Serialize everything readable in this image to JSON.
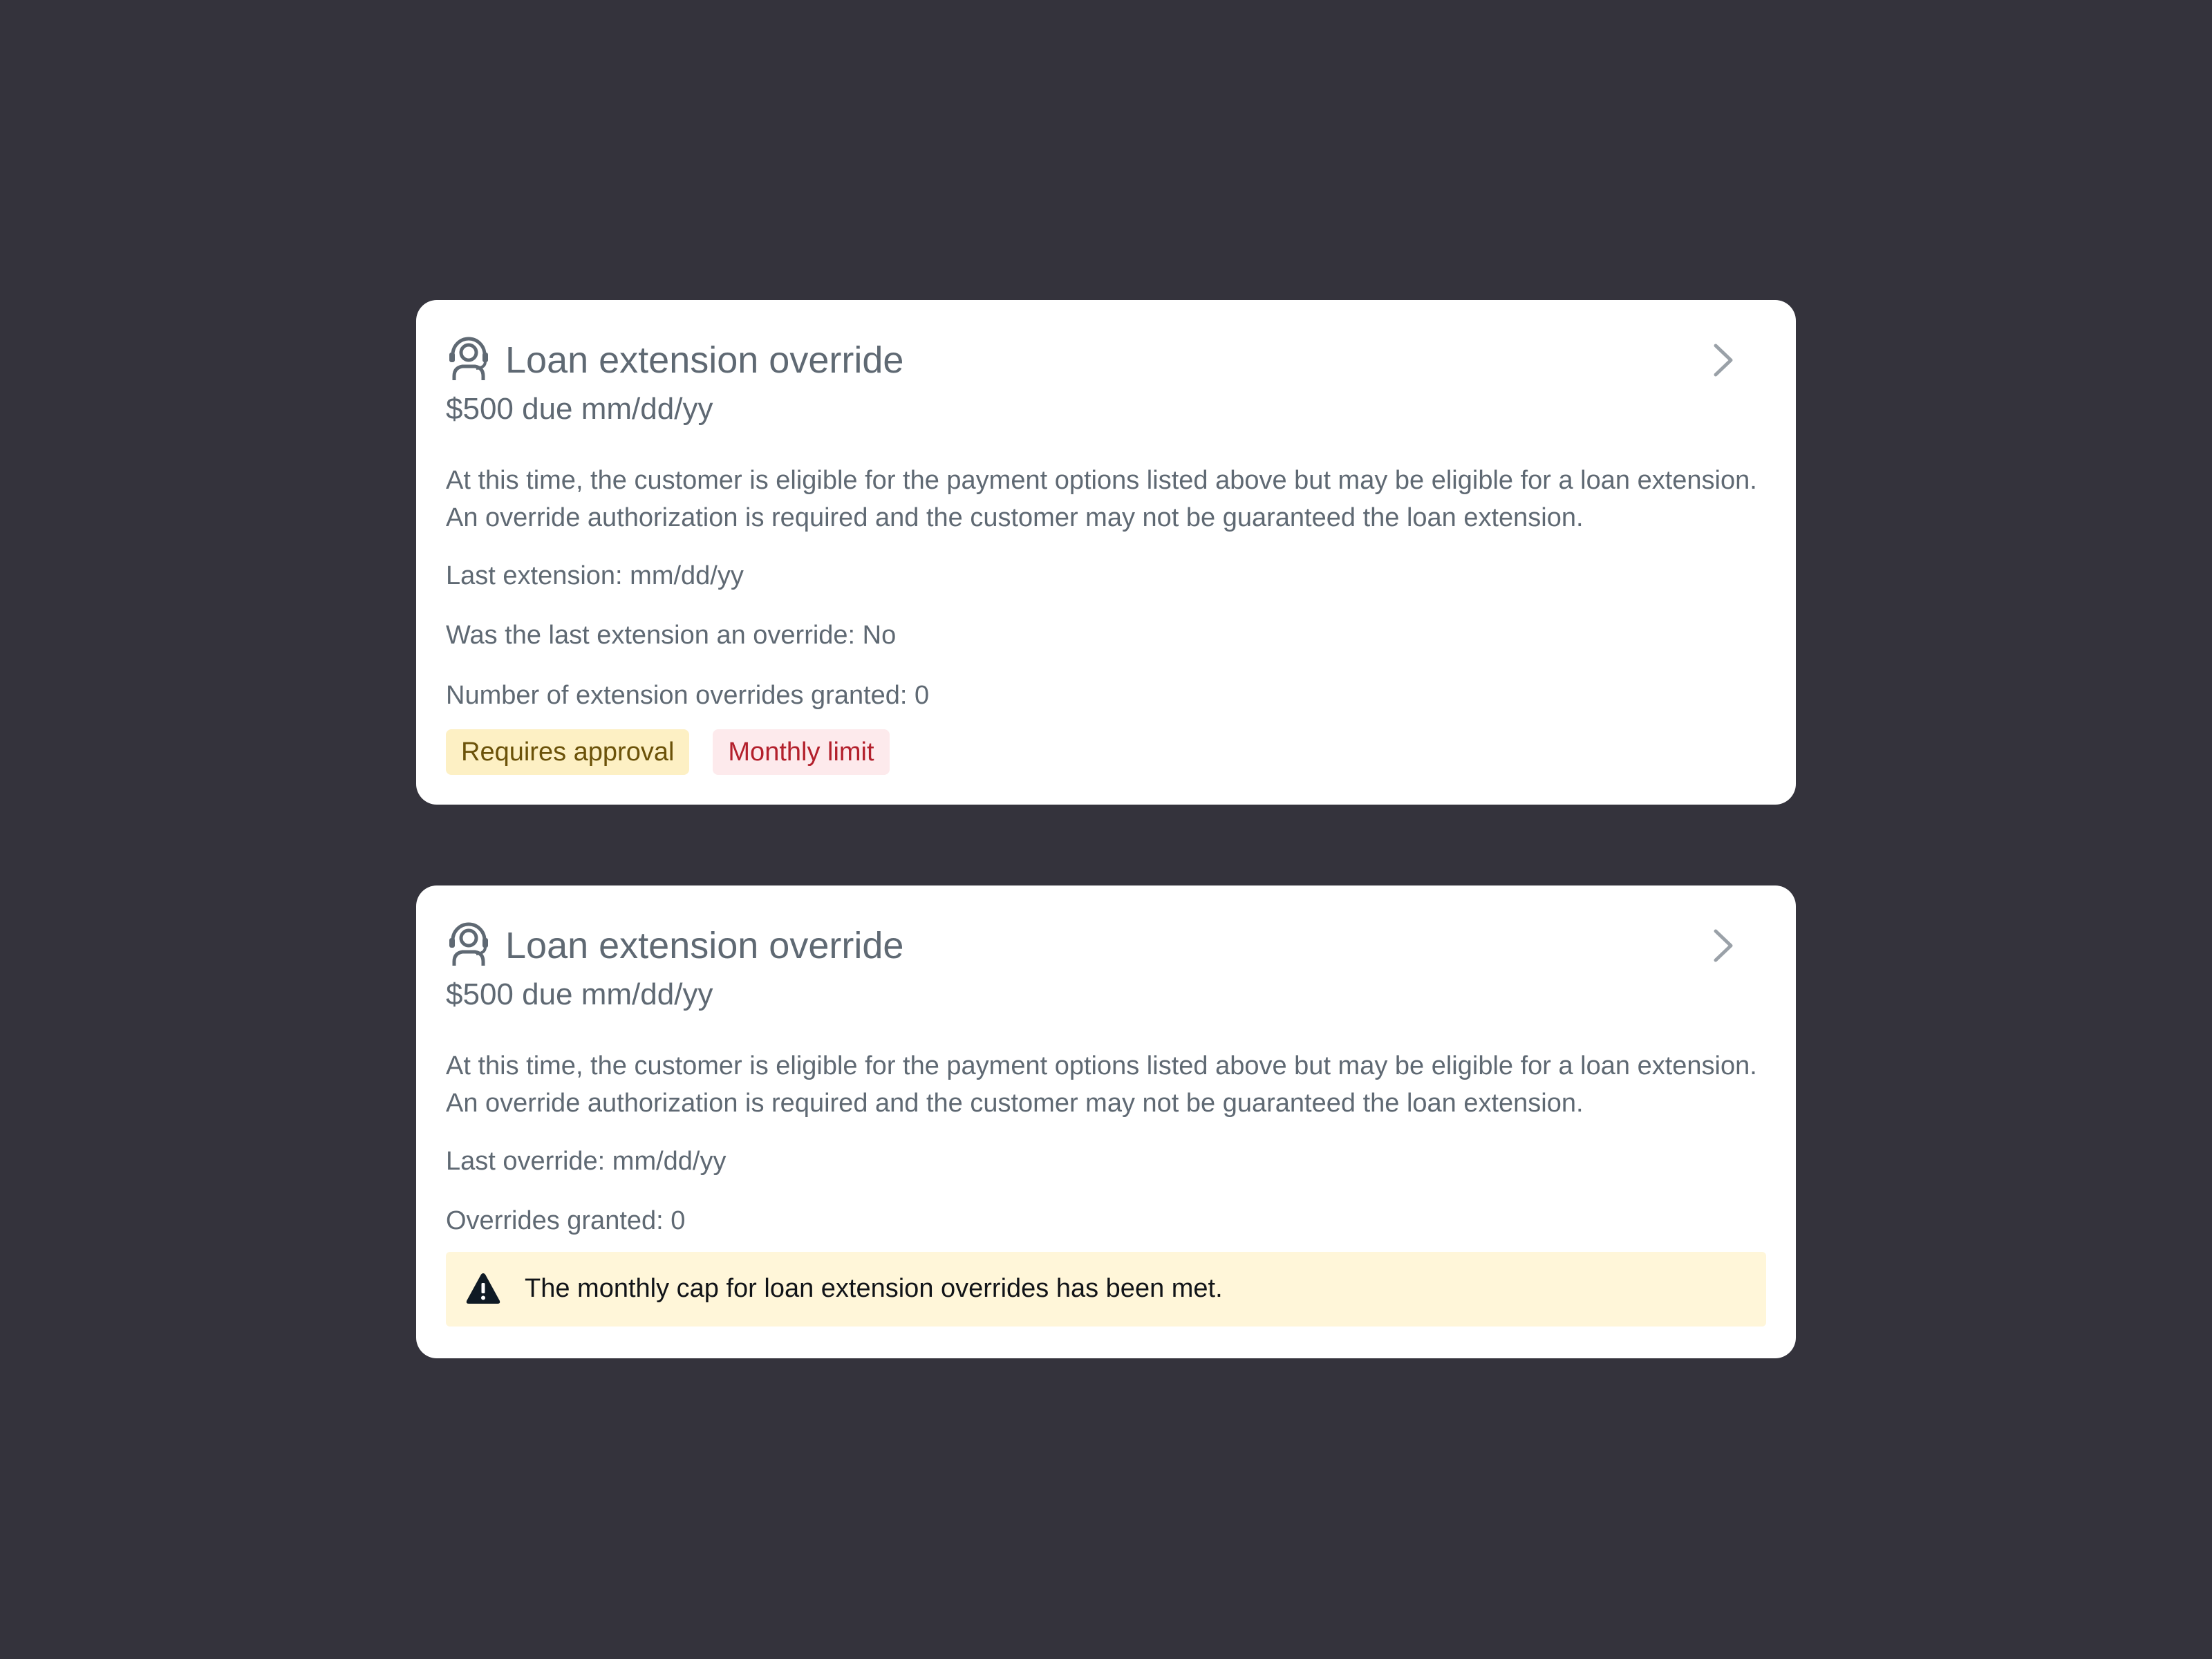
{
  "colors": {
    "background": "#34333c",
    "card": "#ffffff",
    "text_muted": "#5f6973",
    "badge_warning_bg": "#fdf0c4",
    "badge_warning_text": "#6b5209",
    "badge_danger_bg": "#fdeaec",
    "badge_danger_text": "#b3202c",
    "alert_bg": "#fff6d9"
  },
  "cards": [
    {
      "icon": "customer-support-agent-icon",
      "title": "Loan extension override",
      "amount": "$500 due mm/dd/yy",
      "description_lines": [
        "At this time, the customer is eligible for the payment options listed above but may be eligible for a loan extension.",
        "An override authorization is required and the customer may not be guaranteed the loan extension."
      ],
      "details": [
        "Last extension: mm/dd/yy",
        "Was the last extension an override: No",
        "Number of extension overrides granted: 0"
      ],
      "badges": [
        "Requires approval",
        "Monthly limit"
      ],
      "chevron_icon": "chevron-right-icon"
    },
    {
      "icon": "customer-support-agent-icon",
      "title": "Loan extension override",
      "amount": "$500 due mm/dd/yy",
      "description_lines": [
        "At this time, the customer is eligible for the payment options listed above but may be eligible for a loan extension.",
        "An override authorization is required and the customer may not be guaranteed the loan extension."
      ],
      "details": [
        "Last override: mm/dd/yy",
        "Overrides granted: 0"
      ],
      "alert": {
        "icon": "warning-triangle-icon",
        "text": "The monthly cap for loan extension overrides has been met."
      },
      "chevron_icon": "chevron-right-icon"
    }
  ]
}
